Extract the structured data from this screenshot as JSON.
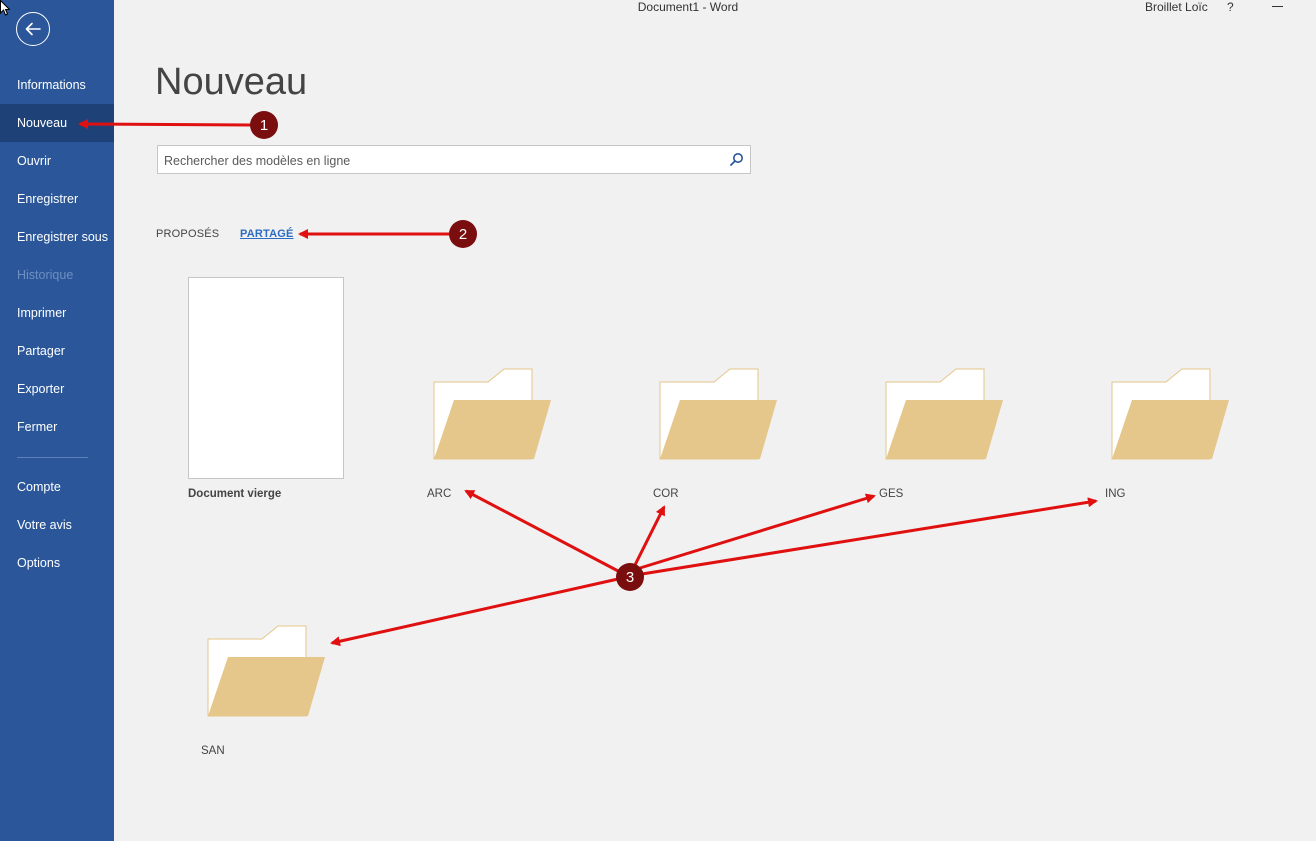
{
  "window": {
    "title": "Document1  -  Word",
    "user": "Broillet Loïc",
    "help": "?"
  },
  "sidebar": {
    "items": [
      {
        "label": "Informations"
      },
      {
        "label": "Nouveau"
      },
      {
        "label": "Ouvrir"
      },
      {
        "label": "Enregistrer"
      },
      {
        "label": "Enregistrer sous"
      },
      {
        "label": "Historique"
      },
      {
        "label": "Imprimer"
      },
      {
        "label": "Partager"
      },
      {
        "label": "Exporter"
      },
      {
        "label": "Fermer"
      },
      {
        "label": "Compte"
      },
      {
        "label": "Votre avis"
      },
      {
        "label": "Options"
      }
    ]
  },
  "main": {
    "title": "Nouveau",
    "search": {
      "placeholder": "Rechercher des modèles en ligne",
      "value": ""
    },
    "tabs": [
      {
        "label": "PROPOSÉS"
      },
      {
        "label": "PARTAGÉ"
      }
    ],
    "blank_document": {
      "label": "Document vierge"
    },
    "folders": [
      {
        "label": "ARC"
      },
      {
        "label": "COR"
      },
      {
        "label": "GES"
      },
      {
        "label": "ING"
      },
      {
        "label": "SAN"
      }
    ]
  },
  "annotations": {
    "badges": [
      "1",
      "2",
      "3"
    ],
    "badge_color": "#7a0d0d",
    "arrow_color": "#e01010"
  },
  "colors": {
    "sidebar": "#2b579a",
    "sidebar_selected": "#1e4278",
    "folder_back": "#ffffff",
    "folder_front": "#e5c68b",
    "link": "#2b6cc4"
  }
}
